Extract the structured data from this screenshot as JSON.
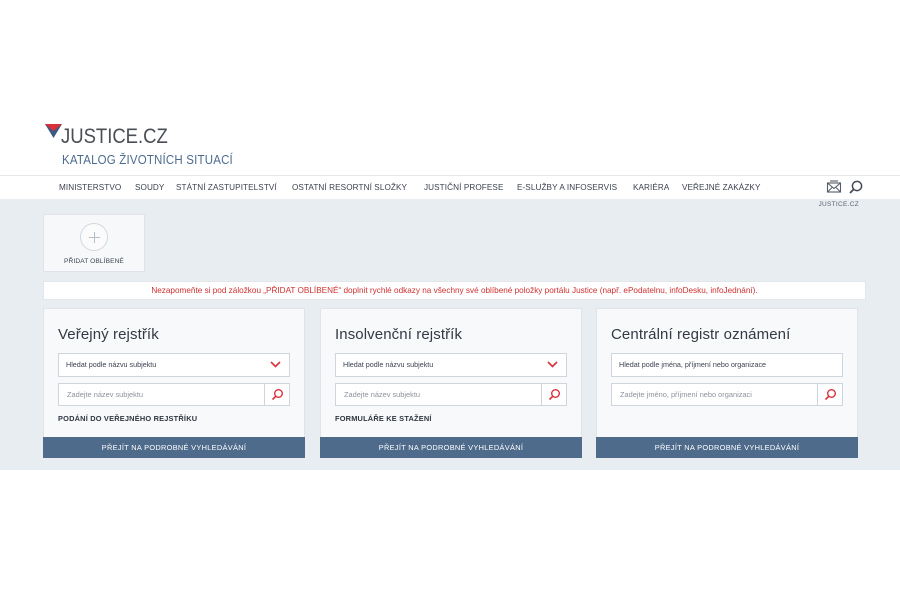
{
  "header": {
    "logo_text": "JUSTICE.CZ",
    "subtitle": "KATALOG ŽIVOTNÍCH SITUACÍ"
  },
  "nav": {
    "items": [
      "MINISTERSTVO",
      "SOUDY",
      "STÁTNÍ ZASTUPITELSTVÍ",
      "OSTATNÍ RESORTNÍ SLOŽKY",
      "JUSTIČNÍ PROFESE",
      "E-SLUŽBY A INFOSERVIS",
      "KARIÉRA",
      "VEŘEJNÉ ZAKÁZKY"
    ],
    "icons": [
      "mail-icon",
      "search-icon"
    ],
    "justice_small": "JUSTICE.CZ"
  },
  "favorites": {
    "label": "PŘIDAT OBLÍBENÉ"
  },
  "notice": {
    "text": "Nezapomeňte si pod záložkou „PŘIDAT OBLÍBENÉ“ doplnit rychlé odkazy na všechny své oblíbené položky portálu Justice (např. ePodatelnu, infoDesku, infoJednání)."
  },
  "cards": [
    {
      "title": "Veřejný rejstřík",
      "select_value": "Hledat podle názvu subjektu",
      "input_placeholder": "Zadejte název subjektu",
      "link": "PODÁNÍ DO VEŘEJNÉHO REJSTŘÍKU",
      "button": "PŘEJÍT NA PODROBNÉ VYHLEDÁVÁNÍ"
    },
    {
      "title": "Insolvenční rejstřík",
      "select_value": "Hledat podle názvu subjektu",
      "input_placeholder": "Zadejte název subjektu",
      "link": "FORMULÁŘE KE STAŽENÍ",
      "button": "PŘEJÍT NA PODROBNÉ VYHLEDÁVÁNÍ"
    },
    {
      "title": "Centrální registr oznámení",
      "select_value": "Hledat podle jména, příjmení nebo organizace",
      "input_placeholder": "Zadejte jméno, příjmení nebo organizaci",
      "link": "",
      "button": "PŘEJÍT NA PODROBNÉ VYHLEDÁVÁNÍ"
    }
  ],
  "colors": {
    "accent_blue": "#4e6b8c",
    "logo_red": "#d9303a",
    "logo_blue": "#3c5a82",
    "notice_red": "#d03030",
    "background": "#e8edf2"
  }
}
